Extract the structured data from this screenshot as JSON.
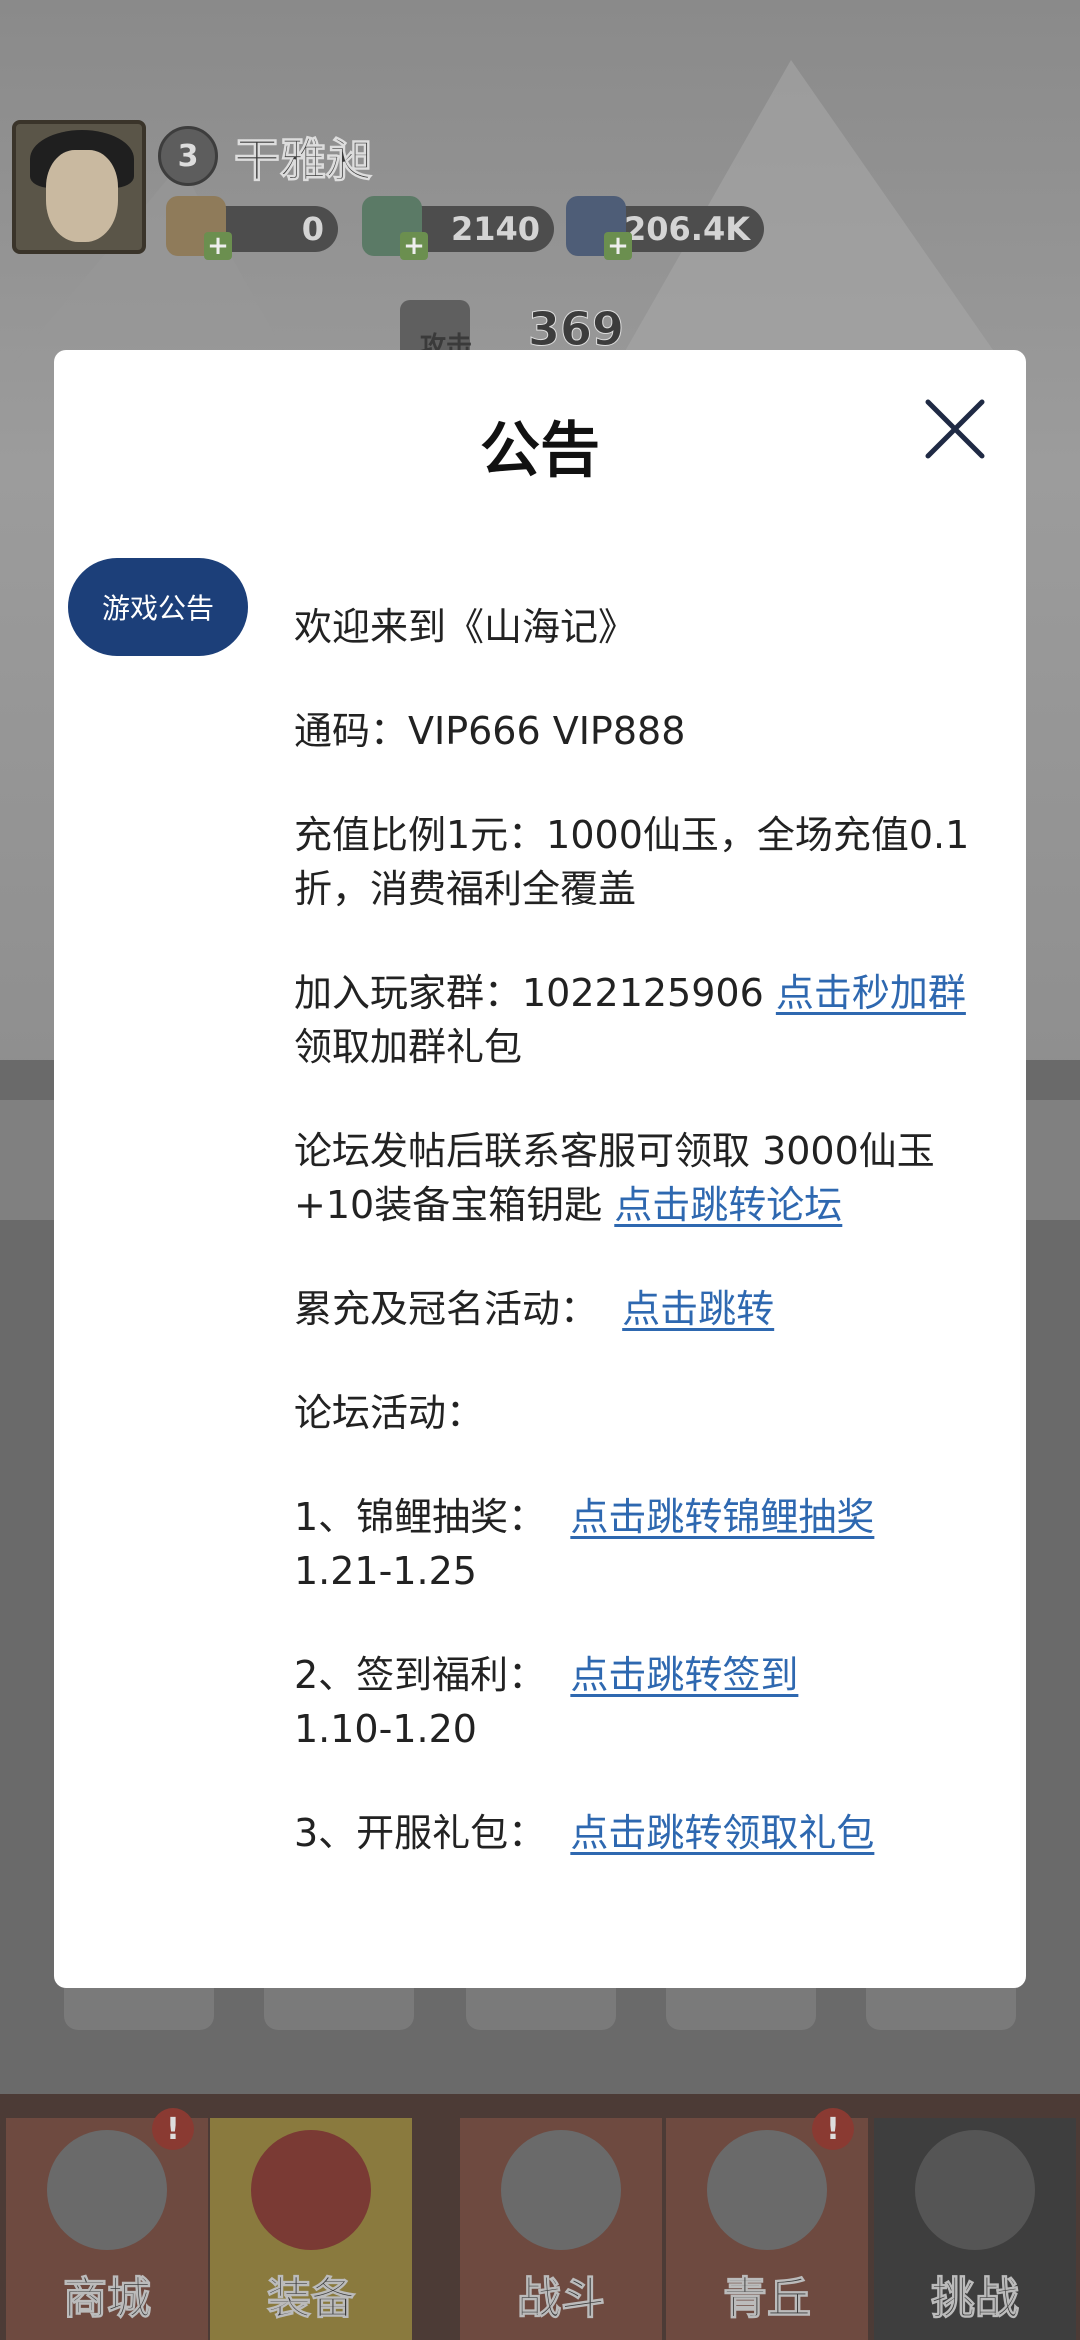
{
  "player": {
    "level": "3",
    "name": "干雅昶",
    "currencies": [
      {
        "icon": "scroll-icon",
        "value": "0"
      },
      {
        "icon": "jade-dragon-icon",
        "value": "2140"
      },
      {
        "icon": "crystal-icon",
        "value": "206.4K"
      }
    ],
    "attack_label": "攻击",
    "attack_value": "369"
  },
  "bottom_nav": [
    {
      "label": "商城",
      "icon": "shop-icon",
      "badge": "!"
    },
    {
      "label": "装备",
      "icon": "helmet-icon",
      "badge": ""
    },
    {
      "label": "战斗",
      "icon": "crossed-swords-icon",
      "badge": ""
    },
    {
      "label": "青丘",
      "icon": "mountain-icon",
      "badge": "!"
    },
    {
      "label": "挑战",
      "icon": "challenge-icon",
      "badge": ""
    }
  ],
  "modal": {
    "title": "公告",
    "tab_label": "游戏公告",
    "welcome": "欢迎来到《山海记》",
    "code_line": "通码：VIP666 VIP888",
    "recharge_line": "充值比例1元：1000仙玉，全场充值0.1折，消费福利全覆盖",
    "group_prefix": "加入玩家群：1022125906 ",
    "group_link": "点击秒加群",
    "group_suffix": " 领取加群礼包",
    "forum_prefix": "论坛发帖后联系客服可领取 3000仙玉+10装备宝箱钥匙 ",
    "forum_link": "点击跳转论坛",
    "activity_prefix": "累充及冠名活动：  ",
    "activity_link": "点击跳转",
    "forum_activity_heading": "论坛活动：",
    "item1_prefix": "1、锦鲤抽奖：  ",
    "item1_link": "点击跳转锦鲤抽奖",
    "item1_dates": "1.21-1.25",
    "item2_prefix": "2、签到福利：  ",
    "item2_link": "点击跳转签到",
    "item2_dates": "1.10-1.20",
    "item3_prefix": "3、开服礼包：  ",
    "item3_link": "点击跳转领取礼包"
  },
  "colors": {
    "tab_bg": "#1c3f79",
    "link": "#2e68b0"
  }
}
